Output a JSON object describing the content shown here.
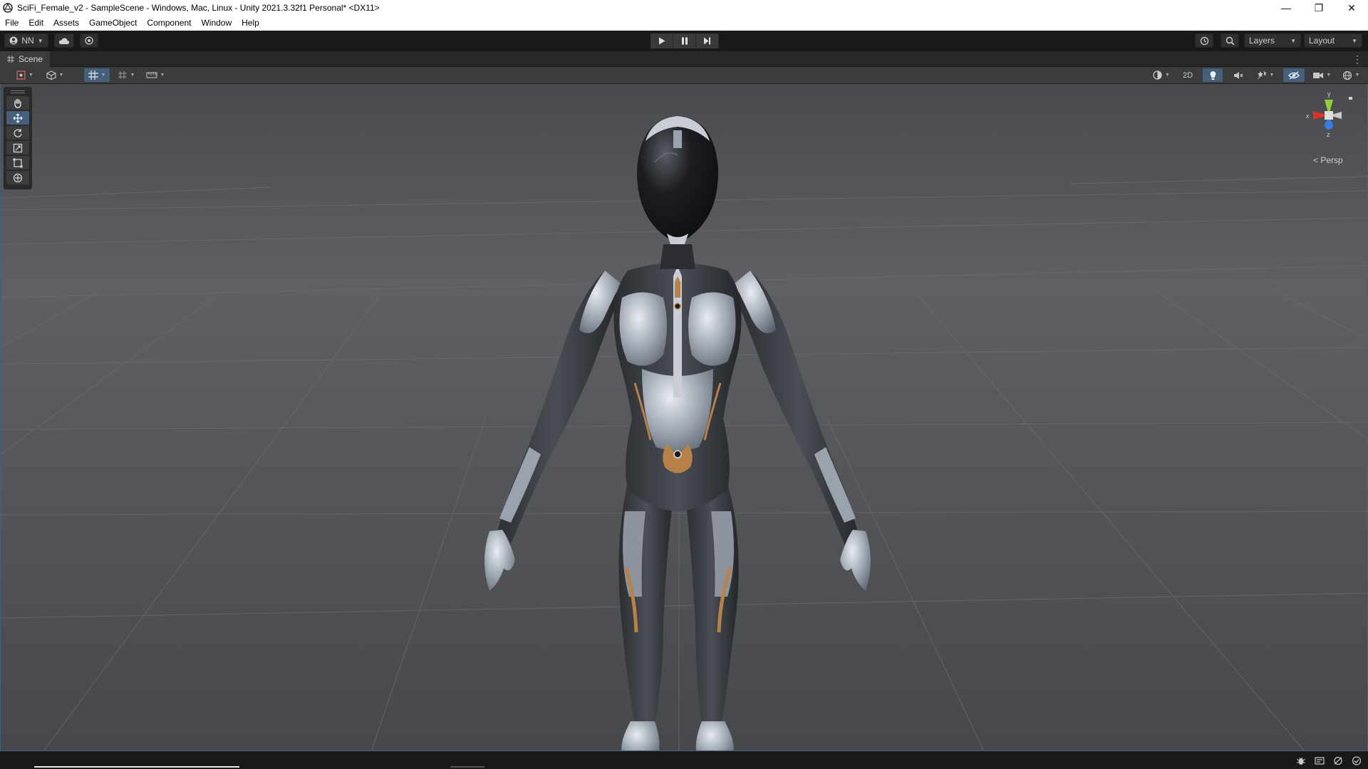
{
  "window": {
    "title": "SciFi_Female_v2 - SampleScene - Windows, Mac, Linux - Unity 2021.3.32f1 Personal* <DX11>",
    "minimize": "—",
    "restore": "❐",
    "close": "✕"
  },
  "menu": [
    "File",
    "Edit",
    "Assets",
    "GameObject",
    "Component",
    "Window",
    "Help"
  ],
  "toolbar": {
    "account_label": "NN",
    "layers_label": "Layers",
    "layout_label": "Layout"
  },
  "scene_tab": {
    "label": "Scene"
  },
  "scene_toolbar": {
    "mode_2d_label": "2D"
  },
  "gizmo": {
    "y": "y",
    "x": "x",
    "z": "z",
    "projection_label": "Persp"
  },
  "colors": {
    "accent": "#46607c",
    "axis_x": "#d6342a",
    "axis_y": "#8fce3c",
    "axis_z": "#3a7de0",
    "viewport_sky": "#5e5f63",
    "viewport_ground": "#46474b"
  },
  "icons": {
    "tools": [
      "hand-tool-icon",
      "move-tool-icon",
      "rotate-tool-icon",
      "scale-tool-icon",
      "rect-tool-icon",
      "transform-tool-icon"
    ],
    "status": [
      "bug-icon",
      "build-icon",
      "connection-icon",
      "check-icon"
    ]
  }
}
